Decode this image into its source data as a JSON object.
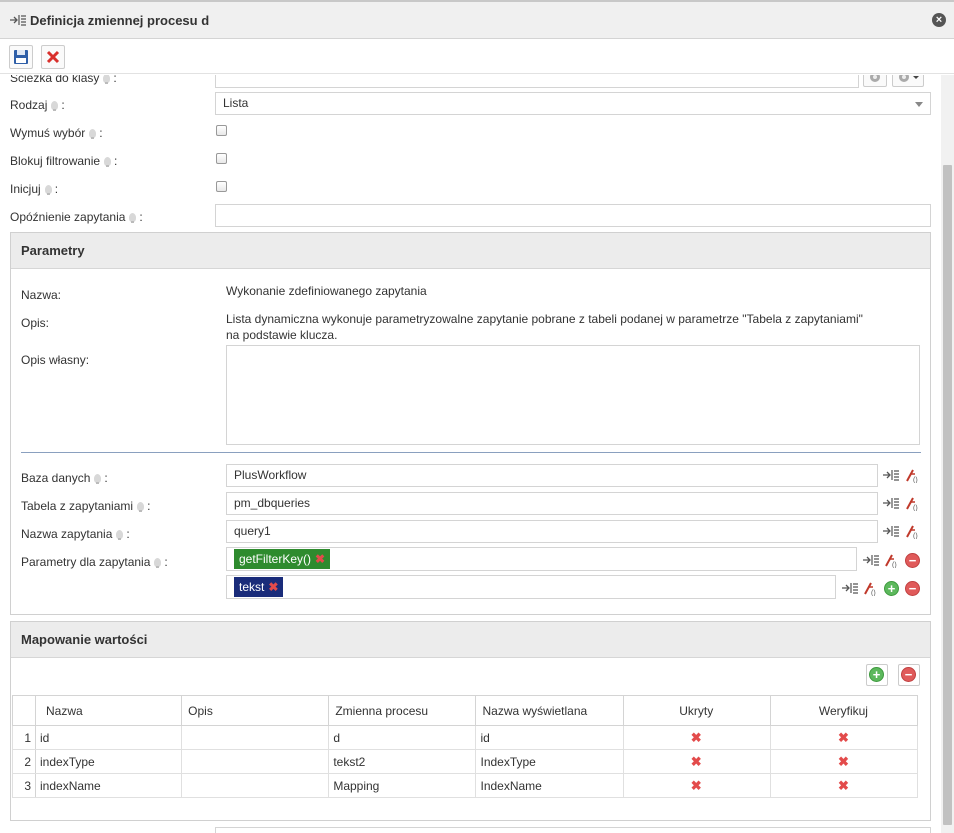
{
  "dialog": {
    "title": "Definicja zmiennej procesu d"
  },
  "toolbar": {
    "save": "save-icon",
    "cancel": "cancel-icon"
  },
  "form": {
    "sciezka_label": "Ścieżka do klasy",
    "rodzaj_label": "Rodzaj",
    "rodzaj_value": "Lista",
    "wymus_label": "Wymuś wybór",
    "blokuj_label": "Blokuj filtrowanie",
    "inicjuj_label": "Inicjuj",
    "opoznienie_label": "Opóźnienie zapytania",
    "colon": ":"
  },
  "parametry": {
    "title": "Parametry",
    "nazwa_label": "Nazwa:",
    "nazwa_value": "Wykonanie zdefiniowanego zapytania",
    "opis_label": "Opis:",
    "opis_value_line1": "Lista dynamiczna wykonuje parametryzowalne zapytanie pobrane z tabeli podanej w parametrze \"Tabela z zapytaniami\"",
    "opis_value_line2": "na podstawie klucza.",
    "opis_wlasny_label": "Opis własny:",
    "baza_label": "Baza danych",
    "baza_value": "PlusWorkflow",
    "tabela_label": "Tabela z zapytaniami",
    "tabela_value": "pm_dbqueries",
    "nazwa_zap_label": "Nazwa zapytania",
    "nazwa_zap_value": "query1",
    "param_label": "Parametry dla zapytania",
    "param_chip1": "getFilterKey()",
    "param_chip2": "tekst"
  },
  "mapowanie": {
    "title": "Mapowanie wartości",
    "columns": [
      "Nazwa",
      "Opis",
      "Zmienna procesu",
      "Nazwa wyświetlana",
      "Ukryty",
      "Weryfikuj"
    ],
    "rows": [
      {
        "n": "1",
        "nazwa": "id",
        "opis": "",
        "zmienna": "d",
        "wyswietlana": "id"
      },
      {
        "n": "2",
        "nazwa": "indexType",
        "opis": "",
        "zmienna": "tekst2",
        "wyswietlana": "IndexType"
      },
      {
        "n": "3",
        "nazwa": "indexName",
        "opis": "",
        "zmienna": "Mapping",
        "wyswietlana": "IndexName"
      }
    ],
    "add_icon": "plus-icon",
    "remove_icon": "minus-icon"
  },
  "colors": {
    "chip_green": "#2e8b2e",
    "chip_navy": "#1a2c7a",
    "x_red": "#e34b4b"
  }
}
